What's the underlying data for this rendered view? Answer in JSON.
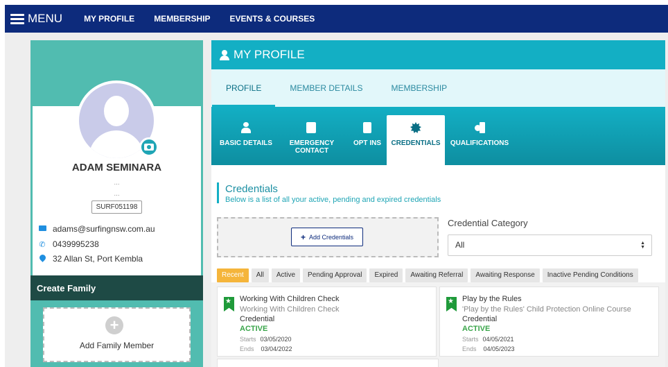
{
  "nav": {
    "menu_label": "MENU",
    "links": [
      "MY PROFILE",
      "MEMBERSHIP",
      "EVENTS & COURSES"
    ]
  },
  "profile": {
    "name": "ADAM SEMINARA",
    "line1": "...",
    "line2": "...",
    "member_id": "SURF051198",
    "email": "adams@surfingnsw.com.au",
    "phone": "0439995238",
    "address": "32 Allan St, Port Kembla"
  },
  "family": {
    "title": "Create Family",
    "add_label": "Add Family Member"
  },
  "main": {
    "header": "MY PROFILE",
    "tabs": [
      "PROFILE",
      "MEMBER DETAILS",
      "MEMBERSHIP"
    ],
    "active_tab": "PROFILE",
    "subtabs": {
      "basic": "BASIC DETAILS",
      "emergency_1": "EMERGENCY",
      "emergency_2": "CONTACT",
      "optins": "OPT INS",
      "credentials": "CREDENTIALS",
      "qualifications": "QUALIFICATIONS"
    },
    "active_subtab": "CREDENTIALS"
  },
  "credentials": {
    "title": "Credentials",
    "subtitle": "Below is a list of all your active, pending and expired credentials",
    "add_button": "Add Credentials",
    "category_label": "Credential Category",
    "category_value": "All",
    "filters": [
      "Recent",
      "All",
      "Active",
      "Pending Approval",
      "Expired",
      "Awaiting Referral",
      "Awaiting Response",
      "Inactive Pending Conditions"
    ],
    "active_filter": "Recent",
    "cards": [
      {
        "title": "Working With Children Check",
        "subtitle": "Working With Children Check",
        "type": "Credential",
        "status": "ACTIVE",
        "starts_label": "Starts",
        "starts": "03/05/2020",
        "ends_label": "Ends",
        "ends": "03/04/2022"
      },
      {
        "title": "Play by the Rules",
        "subtitle": "'Play by the Rules' Child Protection Online Course",
        "type": "Credential",
        "status": "ACTIVE",
        "starts_label": "Starts",
        "starts": "04/05/2021",
        "ends_label": "Ends",
        "ends": "04/05/2023"
      }
    ]
  },
  "colors": {
    "nav": "#0d2b7c",
    "teal": "#13afc4",
    "sidebar": "#51bcb0",
    "family_header": "#1e4a45",
    "active_filter": "#f5b53b",
    "status_active": "#3aa54a"
  }
}
